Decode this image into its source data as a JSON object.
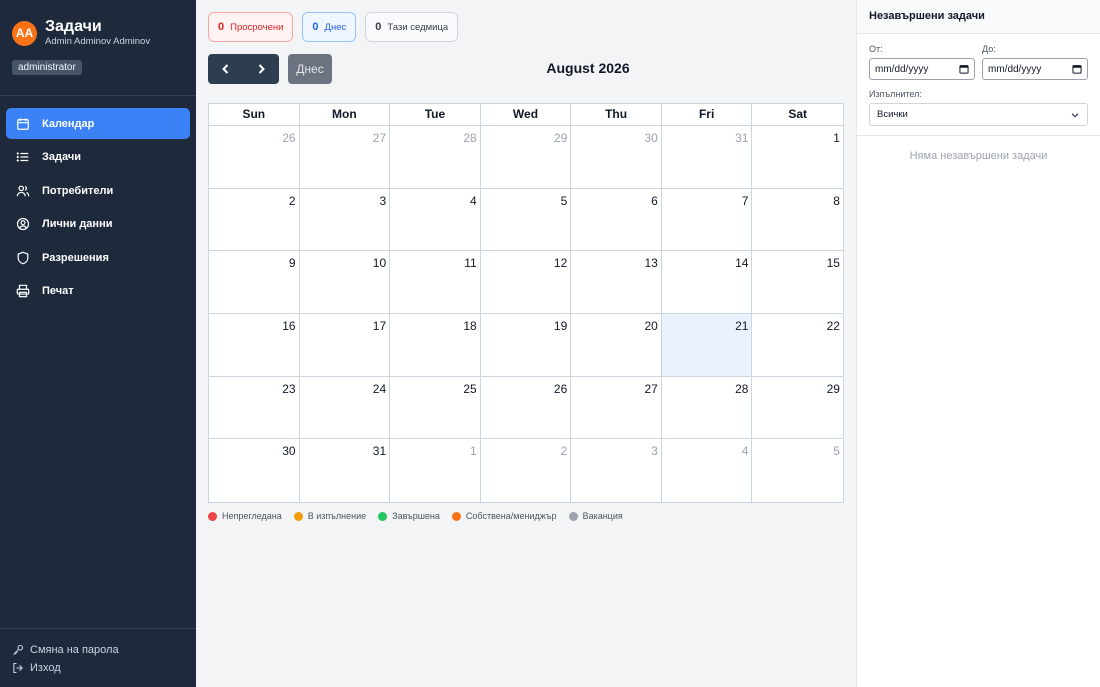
{
  "sidebar": {
    "avatar_initials": "AA",
    "app_title": "Задачи",
    "user_name": "Admin Adminov Adminov",
    "role": "administrator",
    "items": [
      {
        "label": "Календар",
        "icon": "calendar-icon",
        "active": true
      },
      {
        "label": "Задачи",
        "icon": "list-icon",
        "active": false
      },
      {
        "label": "Потребители",
        "icon": "users-icon",
        "active": false
      },
      {
        "label": "Лични данни",
        "icon": "user-circle-icon",
        "active": false
      },
      {
        "label": "Разрешения",
        "icon": "shield-icon",
        "active": false
      },
      {
        "label": "Печат",
        "icon": "printer-icon",
        "active": false
      }
    ],
    "footer": {
      "change_password": "Смяна на парола",
      "logout": "Изход"
    }
  },
  "badges": {
    "overdue": {
      "count": "0",
      "label": "Просрочени"
    },
    "today": {
      "count": "0",
      "label": "Днес"
    },
    "week": {
      "count": "0",
      "label": "Тази седмица"
    }
  },
  "toolbar": {
    "today_label": "Днес",
    "month_title": "August 2026"
  },
  "calendar": {
    "weekdays": [
      "Sun",
      "Mon",
      "Tue",
      "Wed",
      "Thu",
      "Fri",
      "Sat"
    ],
    "weeks": [
      [
        {
          "d": "26",
          "o": true
        },
        {
          "d": "27",
          "o": true
        },
        {
          "d": "28",
          "o": true
        },
        {
          "d": "29",
          "o": true
        },
        {
          "d": "30",
          "o": true
        },
        {
          "d": "31",
          "o": true
        },
        {
          "d": "1"
        }
      ],
      [
        {
          "d": "2"
        },
        {
          "d": "3"
        },
        {
          "d": "4"
        },
        {
          "d": "5"
        },
        {
          "d": "6"
        },
        {
          "d": "7"
        },
        {
          "d": "8"
        }
      ],
      [
        {
          "d": "9"
        },
        {
          "d": "10"
        },
        {
          "d": "11"
        },
        {
          "d": "12"
        },
        {
          "d": "13"
        },
        {
          "d": "14"
        },
        {
          "d": "15"
        }
      ],
      [
        {
          "d": "16"
        },
        {
          "d": "17"
        },
        {
          "d": "18"
        },
        {
          "d": "19"
        },
        {
          "d": "20"
        },
        {
          "d": "21",
          "today": true
        },
        {
          "d": "22"
        }
      ],
      [
        {
          "d": "23"
        },
        {
          "d": "24"
        },
        {
          "d": "25"
        },
        {
          "d": "26"
        },
        {
          "d": "27"
        },
        {
          "d": "28"
        },
        {
          "d": "29"
        }
      ],
      [
        {
          "d": "30"
        },
        {
          "d": "31"
        },
        {
          "d": "1",
          "o": true
        },
        {
          "d": "2",
          "o": true
        },
        {
          "d": "3",
          "o": true
        },
        {
          "d": "4",
          "o": true
        },
        {
          "d": "5",
          "o": true
        }
      ]
    ]
  },
  "legend": [
    {
      "label": "Непрегледана",
      "color": "#ef4444"
    },
    {
      "label": "В изпълнение",
      "color": "#f59e0b"
    },
    {
      "label": "Завършена",
      "color": "#22c55e"
    },
    {
      "label": "Собствена/мениджър",
      "color": "#f97316"
    },
    {
      "label": "Ваканция",
      "color": "#9ca3af"
    }
  ],
  "panel": {
    "title": "Незавършени задачи",
    "from_label": "От:",
    "to_label": "До:",
    "from_value": "mm/dd/yyyy",
    "to_value": "mm/dd/yyyy",
    "assignee_label": "Изпълнител:",
    "assignee_value": "Всички",
    "empty_text": "Няма незавършени задачи"
  }
}
